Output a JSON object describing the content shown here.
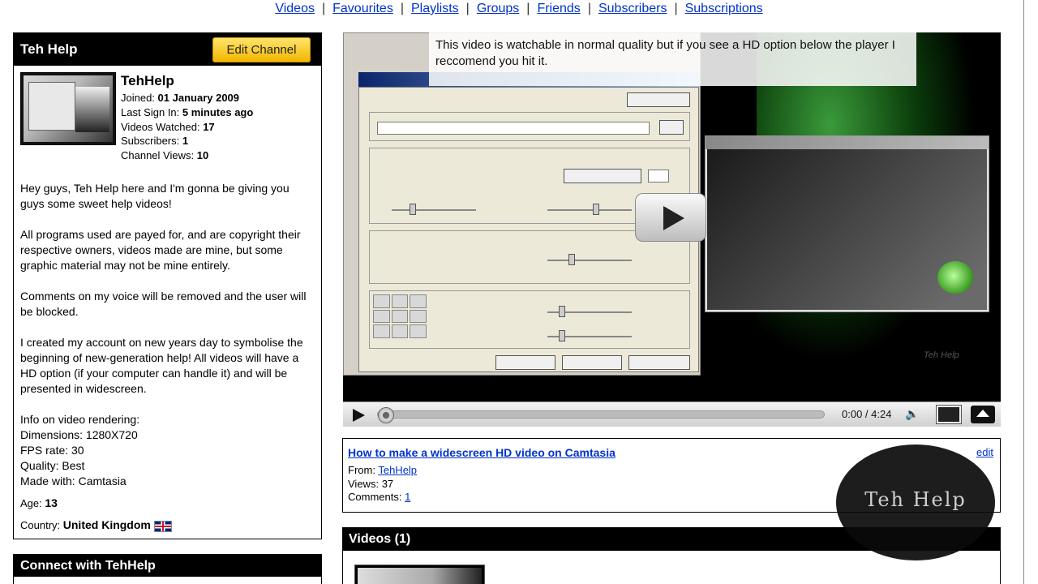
{
  "nav": {
    "items": [
      "Videos",
      "Favourites",
      "Playlists",
      "Groups",
      "Friends",
      "Subscribers",
      "Subscriptions"
    ],
    "separator": "|"
  },
  "profile": {
    "title": "Teh Help",
    "edit_button": "Edit Channel",
    "name": "TehHelp",
    "joined_label": "Joined:",
    "joined_value": "01 January 2009",
    "last_signin_label": "Last Sign In:",
    "last_signin_value": "5 minutes ago",
    "videos_watched_label": "Videos Watched:",
    "videos_watched_value": "17",
    "subscribers_label": "Subscribers:",
    "subscribers_value": "1",
    "channel_views_label": "Channel Views:",
    "channel_views_value": "10",
    "description": [
      "Hey guys, Teh Help here and I'm gonna be giving you guys some sweet help videos!",
      "All programs used are payed for, and are copyright their respective owners, videos made are mine, but some graphic material may not be mine entirely.",
      "Comments on my voice will be removed and the user will be blocked.",
      "I created my account on new years day to symbolise the beginning of new-generation help! All videos will have a HD option (if your computer can handle it) and will be presented in widescreen."
    ],
    "render_info": [
      "Info on video rendering:",
      "Dimensions: 1280X720",
      "FPS rate: 30",
      "Quality: Best",
      "Made with: Camtasia"
    ],
    "age_label": "Age:",
    "age_value": "13",
    "country_label": "Country:",
    "country_value": "United Kingdom",
    "flag_icon": "uk-flag-icon"
  },
  "connect": {
    "title": "Connect with TehHelp"
  },
  "player": {
    "annotation": "This video is watchable in normal quality but if you see a HD option below the player I reccomend you hit it.",
    "time": "0:00 / 4:24",
    "progress": 0.0,
    "watermark_text": "Teh Help"
  },
  "video_info": {
    "title": "How to make a widescreen HD video on Camtasia",
    "edit": "edit",
    "from_label": "From:",
    "from_value": "TehHelp",
    "views_label": "Views:",
    "views_value": "37",
    "comments_label": "Comments:",
    "comments_value": "1"
  },
  "videos_section": {
    "title": "Videos (1)"
  },
  "logo_watermark": "Teh Help"
}
